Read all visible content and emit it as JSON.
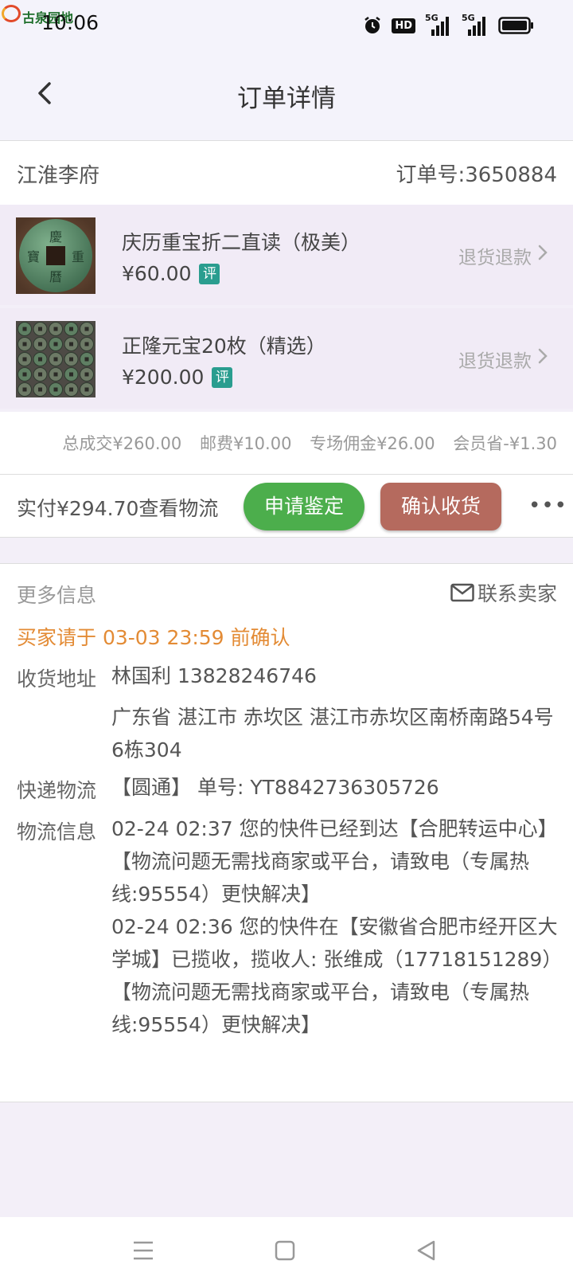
{
  "status_bar": {
    "logo_text": "古泉园地",
    "time": "10:06",
    "hd_label": "HD",
    "signal_1": "5G",
    "signal_2": "5G"
  },
  "header": {
    "title": "订单详情"
  },
  "shop": {
    "name": "江淮李府",
    "order_no": "订单号:3650884"
  },
  "items": [
    {
      "name": "庆历重宝折二直读（极美）",
      "price": "¥60.00",
      "badge": "评",
      "refund": "退货退款"
    },
    {
      "name": "正隆元宝20枚（精选）",
      "price": "¥200.00",
      "badge": "评",
      "refund": "退货退款"
    }
  ],
  "fees": {
    "total": "总成交¥260.00",
    "shipping": "邮费¥10.00",
    "commission": "专场佣金¥26.00",
    "member": "会员省-¥1.30"
  },
  "payment": {
    "paid": "实付¥294.70",
    "view_logistics": "查看物流",
    "appraise_button": "申请鉴定",
    "confirm_button": "确认收货",
    "more": "•••"
  },
  "info": {
    "title": "更多信息",
    "contact": "联系卖家",
    "deadline": "买家请于 03-03 23:59 前确认",
    "address_label": "收货地址",
    "address_contact": "林国利 13828246746",
    "address_detail": "广东省 湛江市 赤坎区 湛江市赤坎区南桥南路54号6栋304",
    "express_label": "快递物流",
    "express_value": "【圆通】 单号: YT8842736305726",
    "logistics_label": "物流信息",
    "logistics": [
      "02-24 02:37 您的快件已经到达【合肥转运中心】【物流问题无需找商家或平台，请致电（专属热线:95554）更快解决】",
      "02-24 02:36 您的快件在【安徽省合肥市经开区大学城】已揽收，揽收人: 张维成（17718151289）【物流问题无需找商家或平台，请致电（专属热线:95554）更快解决】"
    ]
  },
  "colors": {
    "accent_green": "#4cae4c",
    "accent_brown": "#b56a5e",
    "deadline_orange": "#e38b35",
    "badge_teal": "#2a9d8f"
  }
}
